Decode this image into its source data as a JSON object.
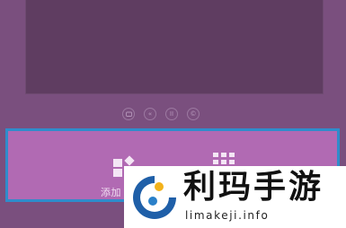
{
  "player": {
    "controls": [
      {
        "icon": "camera-icon"
      },
      {
        "icon": "rewind-icon",
        "glyph": "«"
      },
      {
        "icon": "pause-icon",
        "glyph": "II"
      },
      {
        "icon": "copyright-icon",
        "glyph": "©"
      }
    ]
  },
  "toolbar": {
    "add_label": "添加",
    "add_icon": "add-widget-icon",
    "grid_icon": "app-grid-icon",
    "highlight_color": "#2f8ccb",
    "bar_color": "#b16ab3"
  },
  "watermark": {
    "title": "利玛手游",
    "url": "limakeji.info",
    "logo_icon": "limakeji-logo-icon"
  }
}
